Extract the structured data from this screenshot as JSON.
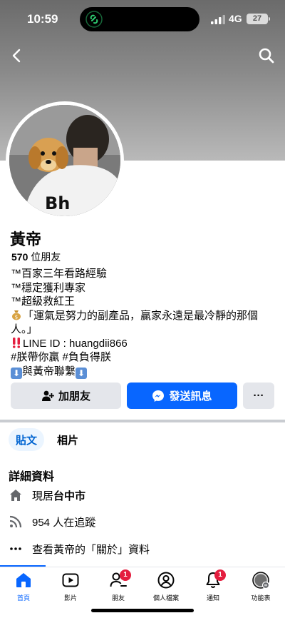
{
  "status_bar": {
    "time": "10:59",
    "network": "4G",
    "battery": "27"
  },
  "profile": {
    "name": "黃帝",
    "friends_count": "570",
    "friends_label": "位朋友",
    "bio": [
      "™百家三年看路經驗",
      "™穩定獲利專家",
      "™超級救紅王",
      "「運氣是努力的副產品，贏家永遠是最冷靜的那個人。」",
      "LINE ID : huangdii866",
      "#朕帶你贏 #負負得朕",
      "與黃帝聯繫"
    ]
  },
  "actions": {
    "add_friend": "加朋友",
    "send_message": "發送訊息",
    "more": "···"
  },
  "tabs": [
    {
      "label": "貼文"
    },
    {
      "label": "相片"
    }
  ],
  "details": {
    "title": "詳細資料",
    "lives_in_prefix": "現居",
    "lives_in_city": "台中市",
    "followers": "954 人在追蹤",
    "see_about": "查看黃帝的「關於」資料"
  },
  "nav": [
    {
      "label": "首頁"
    },
    {
      "label": "影片"
    },
    {
      "label": "朋友",
      "badge": "1"
    },
    {
      "label": "個人檔案"
    },
    {
      "label": "通知",
      "badge": "1"
    },
    {
      "label": "功能表"
    }
  ],
  "colors": {
    "accent": "#0866ff",
    "badge": "#e41e3f",
    "button_gray": "#e4e6eb",
    "tab_active_bg": "#ebf5ff"
  }
}
